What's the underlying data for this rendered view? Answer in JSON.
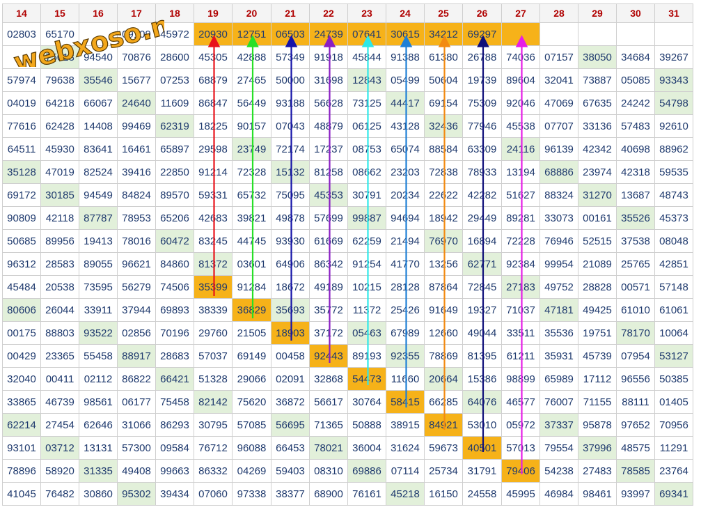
{
  "watermark": "webxoso.net",
  "header": [
    "14",
    "15",
    "16",
    "17",
    "18",
    "19",
    "20",
    "21",
    "22",
    "23",
    "24",
    "25",
    "26",
    "27",
    "28",
    "29",
    "30",
    "31"
  ],
  "rows": [
    [
      "02803",
      "65170",
      "",
      "09109",
      "45972",
      "20930",
      "12751",
      "06503",
      "24739",
      "07641",
      "30615",
      "34212",
      "69297",
      "",
      "",
      "",
      "",
      ""
    ],
    [
      "",
      "75013",
      "94540",
      "70876",
      "28600",
      "45305",
      "42888",
      "57349",
      "91918",
      "45844",
      "91388",
      "61380",
      "26788",
      "74036",
      "07157",
      "38050",
      "34684",
      "39267"
    ],
    [
      "57974",
      "79638",
      "35546",
      "15677",
      "07253",
      "68879",
      "27465",
      "50000",
      "31698",
      "12843",
      "05499",
      "50604",
      "19739",
      "89604",
      "32041",
      "73887",
      "05085",
      "93343"
    ],
    [
      "04019",
      "64218",
      "66067",
      "24640",
      "11609",
      "86847",
      "56449",
      "93188",
      "56628",
      "73125",
      "44417",
      "69154",
      "75309",
      "92046",
      "47069",
      "67635",
      "24242",
      "54798"
    ],
    [
      "77616",
      "62428",
      "14408",
      "99469",
      "62319",
      "18225",
      "90157",
      "07043",
      "48879",
      "06125",
      "43128",
      "32436",
      "77946",
      "45538",
      "07707",
      "33136",
      "57483",
      "92610"
    ],
    [
      "64511",
      "45930",
      "83641",
      "16461",
      "65897",
      "29598",
      "23749",
      "72174",
      "17237",
      "08753",
      "65074",
      "88584",
      "63309",
      "24116",
      "96139",
      "42342",
      "40698",
      "88962"
    ],
    [
      "35128",
      "47019",
      "82524",
      "39416",
      "22850",
      "91214",
      "72328",
      "15132",
      "81258",
      "08662",
      "23203",
      "72838",
      "78933",
      "13194",
      "68886",
      "23974",
      "42318",
      "59535"
    ],
    [
      "69172",
      "30185",
      "94549",
      "84824",
      "89570",
      "59331",
      "65732",
      "75095",
      "45353",
      "30791",
      "20234",
      "22622",
      "42282",
      "51627",
      "88324",
      "31270",
      "13687",
      "48743"
    ],
    [
      "90809",
      "42118",
      "87787",
      "78953",
      "65206",
      "42683",
      "39821",
      "49878",
      "57699",
      "99887",
      "94694",
      "18942",
      "29449",
      "89281",
      "33073",
      "00161",
      "35526",
      "45373"
    ],
    [
      "50685",
      "89956",
      "19413",
      "78016",
      "60472",
      "83245",
      "44745",
      "93930",
      "61669",
      "62259",
      "21494",
      "76970",
      "16894",
      "72228",
      "76946",
      "52515",
      "37538",
      "08048"
    ],
    [
      "96312",
      "28583",
      "89055",
      "96621",
      "84860",
      "81372",
      "03601",
      "64906",
      "86342",
      "91254",
      "41770",
      "13256",
      "62771",
      "92384",
      "99954",
      "21089",
      "25765",
      "42851"
    ],
    [
      "45484",
      "20538",
      "73595",
      "56279",
      "74506",
      "35399",
      "91284",
      "18672",
      "49189",
      "10215",
      "28128",
      "87864",
      "72845",
      "27183",
      "49752",
      "28828",
      "00571",
      "57148"
    ],
    [
      "80606",
      "26044",
      "33911",
      "37944",
      "69893",
      "38339",
      "36829",
      "35693",
      "35772",
      "11372",
      "25426",
      "91649",
      "19327",
      "71037",
      "47181",
      "49425",
      "61010",
      "61061"
    ],
    [
      "00175",
      "88803",
      "93522",
      "02856",
      "70196",
      "29760",
      "21505",
      "18903",
      "37172",
      "05463",
      "67989",
      "12660",
      "49044",
      "33511",
      "35536",
      "19751",
      "78170",
      "10064"
    ],
    [
      "00429",
      "23365",
      "55458",
      "88917",
      "28683",
      "57037",
      "69149",
      "00458",
      "92443",
      "89193",
      "92355",
      "78869",
      "81395",
      "61211",
      "35931",
      "45739",
      "07954",
      "53127"
    ],
    [
      "32040",
      "00411",
      "02112",
      "86822",
      "66421",
      "51328",
      "29066",
      "02091",
      "32868",
      "54473",
      "11660",
      "20664",
      "15386",
      "98899",
      "65989",
      "17112",
      "96556",
      "50385"
    ],
    [
      "33865",
      "46739",
      "98561",
      "06177",
      "75458",
      "82142",
      "75620",
      "36872",
      "56617",
      "30764",
      "58415",
      "66285",
      "64076",
      "46577",
      "76007",
      "71155",
      "88111",
      "01405"
    ],
    [
      "62214",
      "27454",
      "62646",
      "31066",
      "86293",
      "30795",
      "57085",
      "56695",
      "71365",
      "50888",
      "38915",
      "84921",
      "53010",
      "05972",
      "37337",
      "95878",
      "97652",
      "70956"
    ],
    [
      "93101",
      "03712",
      "13131",
      "57300",
      "09584",
      "76712",
      "96088",
      "66453",
      "78021",
      "36004",
      "31624",
      "59673",
      "40501",
      "57013",
      "79554",
      "37996",
      "48575",
      "11291"
    ],
    [
      "78896",
      "58920",
      "31335",
      "49408",
      "99663",
      "86332",
      "04269",
      "59403",
      "08310",
      "69886",
      "07114",
      "25734",
      "31791",
      "79406",
      "54238",
      "27483",
      "78585",
      "23764"
    ],
    [
      "41045",
      "76482",
      "30860",
      "95302",
      "39434",
      "07060",
      "97338",
      "38377",
      "68900",
      "76161",
      "45218",
      "16150",
      "24558",
      "45995",
      "46984",
      "98461",
      "93997",
      "69341"
    ]
  ],
  "green_cells": [
    [
      1,
      1
    ],
    [
      2,
      2
    ],
    [
      2,
      9
    ],
    [
      3,
      3
    ],
    [
      3,
      10
    ],
    [
      3,
      17
    ],
    [
      4,
      4
    ],
    [
      4,
      11
    ],
    [
      5,
      6
    ],
    [
      5,
      13
    ],
    [
      6,
      0
    ],
    [
      6,
      7
    ],
    [
      6,
      14
    ],
    [
      7,
      1
    ],
    [
      7,
      8
    ],
    [
      7,
      15
    ],
    [
      8,
      2
    ],
    [
      8,
      9
    ],
    [
      8,
      16
    ],
    [
      9,
      4
    ],
    [
      9,
      11
    ],
    [
      10,
      5
    ],
    [
      10,
      12
    ],
    [
      11,
      13
    ],
    [
      12,
      0
    ],
    [
      12,
      7
    ],
    [
      12,
      14
    ],
    [
      13,
      2
    ],
    [
      13,
      9
    ],
    [
      13,
      16
    ],
    [
      14,
      3
    ],
    [
      14,
      10
    ],
    [
      14,
      17
    ],
    [
      15,
      4
    ],
    [
      15,
      11
    ],
    [
      16,
      5
    ],
    [
      16,
      12
    ],
    [
      17,
      0
    ],
    [
      17,
      7
    ],
    [
      17,
      14
    ],
    [
      18,
      1
    ],
    [
      18,
      8
    ],
    [
      18,
      15
    ],
    [
      19,
      2
    ],
    [
      19,
      9
    ],
    [
      19,
      16
    ],
    [
      20,
      3
    ],
    [
      20,
      10
    ],
    [
      20,
      17
    ],
    [
      1,
      15
    ],
    [
      2,
      17
    ]
  ],
  "arrows": [
    {
      "col": 5,
      "from_row": 12,
      "to_row": 0,
      "color": "#e8131b"
    },
    {
      "col": 6,
      "from_row": 13,
      "to_row": 0,
      "color": "#27e027"
    },
    {
      "col": 7,
      "from_row": 14,
      "to_row": 0,
      "color": "#1614a8"
    },
    {
      "col": 8,
      "from_row": 15,
      "to_row": 0,
      "color": "#8a1fc4"
    },
    {
      "col": 9,
      "from_row": 16,
      "to_row": 0,
      "color": "#2ee8e8"
    },
    {
      "col": 10,
      "from_row": 17,
      "to_row": 0,
      "color": "#1e7fd6"
    },
    {
      "col": 11,
      "from_row": 18,
      "to_row": 0,
      "color": "#f28a12"
    },
    {
      "col": 12,
      "from_row": 19,
      "to_row": 0,
      "color": "#10107a"
    },
    {
      "col": 13,
      "from_row": 20,
      "to_row": 0,
      "color": "#e61ee6"
    }
  ],
  "orange_cells": [
    [
      0,
      5
    ],
    [
      0,
      6
    ],
    [
      0,
      7
    ],
    [
      0,
      8
    ],
    [
      0,
      9
    ],
    [
      0,
      10
    ],
    [
      0,
      11
    ],
    [
      0,
      12
    ],
    [
      0,
      13
    ],
    [
      11,
      5
    ],
    [
      12,
      6
    ],
    [
      13,
      7
    ],
    [
      14,
      8
    ],
    [
      15,
      9
    ],
    [
      16,
      10
    ],
    [
      17,
      11
    ],
    [
      18,
      12
    ],
    [
      19,
      13
    ]
  ],
  "colors": {
    "orange": "#f6b219",
    "green": "#e2f0da",
    "header_text": "#b00000",
    "cell_text": "#1f3a6e"
  }
}
